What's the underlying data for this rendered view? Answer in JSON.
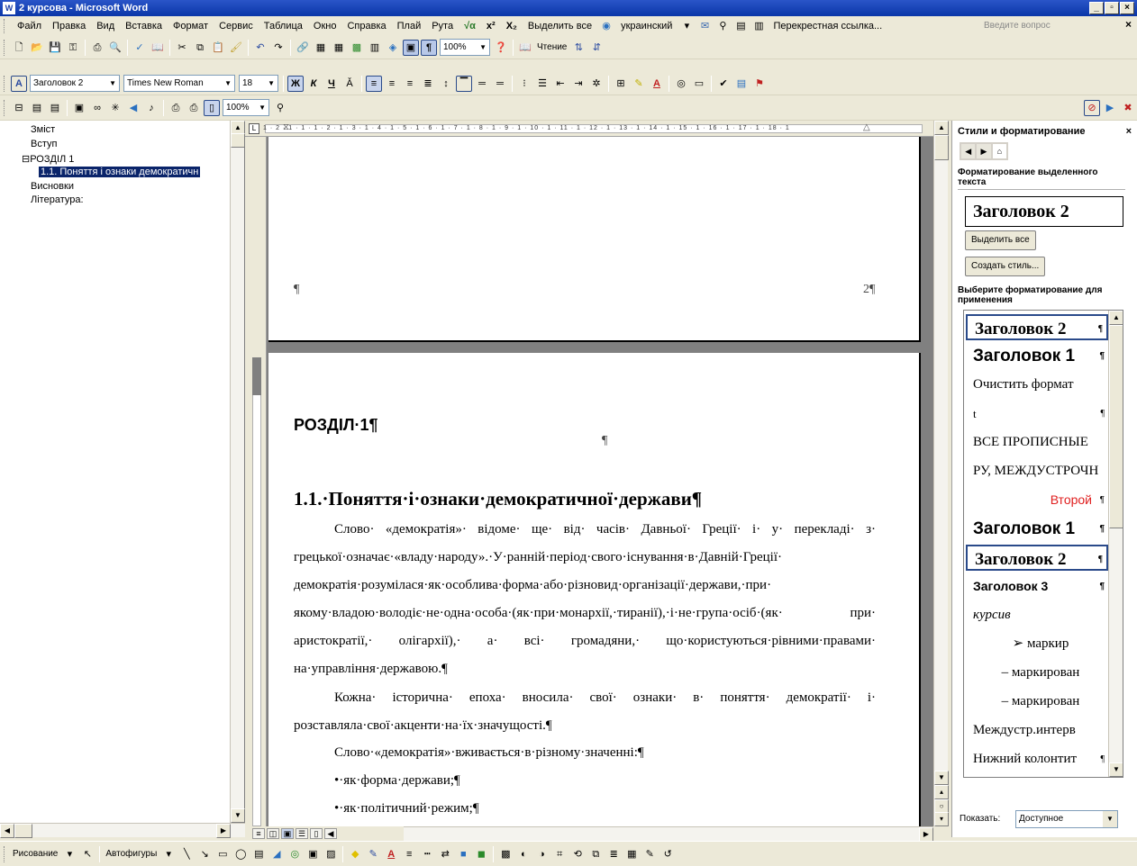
{
  "window": {
    "title": "2 курсова - Microsoft Word",
    "icon_letter": "W",
    "buttons": {
      "minimize": "_",
      "maximize": "▫",
      "close": "×"
    }
  },
  "menubar": {
    "items": [
      "Файл",
      "Правка",
      "Вид",
      "Вставка",
      "Формат",
      "Сервис",
      "Таблица",
      "Окно",
      "Справка",
      "Плай",
      "Рута"
    ],
    "extras": [
      "√α",
      "x²",
      "X₂",
      "Выделить все",
      "украинский",
      "Перекрестная ссылка..."
    ],
    "help_placeholder": "Введите вопрос",
    "close_label": "×"
  },
  "toolbar_standard": {
    "zoom": "100%",
    "reading_label": "Чтение"
  },
  "toolbar_formatting": {
    "style": "Заголовок 2",
    "font": "Times New Roman",
    "size": "18",
    "bold": "Ж",
    "italic": "К",
    "underline": "Ч"
  },
  "toolbar_extra": {
    "zoom": "100%"
  },
  "document_map": {
    "items": [
      {
        "label": "Зміст",
        "level": 1,
        "selected": false
      },
      {
        "label": "Вступ",
        "level": 1,
        "selected": false
      },
      {
        "label": "⊟РОЗДІЛ 1",
        "level": 1,
        "selected": false
      },
      {
        "label": "1.1. Поняття і ознаки демократичн",
        "level": 2,
        "selected": true
      },
      {
        "label": "Висновки",
        "level": 1,
        "selected": false
      },
      {
        "label": "Література:",
        "level": 1,
        "selected": false
      }
    ]
  },
  "ruler": {
    "numbers": "1 · 2 · 1 · 1 · 1 · 2 · 1 · 3 · 1 · 4 · 1 · 5 · 1 · 6 · 1 · 7 · 1 · 8 · 1 · 9 · 1 · 10 · 1 · 11 · 1 · 12 · 1 · 13 · 1 · 14 · 1 · 15 · 1 · 16 · 1 · 17 · 1 · 18 · 1"
  },
  "document": {
    "page1": {
      "pilcrow": "¶",
      "page_number": "2¶"
    },
    "chapter_heading": "РОЗДІЛ·1¶",
    "empty_para": "¶",
    "section_heading": "1.1.·Поняття·і·ознаки·демократичної·держави¶",
    "paragraph1": "Слово· «демократія»· відоме· ще· від· часів· Давньої· Греції· і· у· перекладі· з· грецької·означає·«владу·народу».·У·ранній·період·свого·існування·в·Давній·Греції· демократія·розумілася·як·особлива·форма·або·різновид·організації·держави,·при· якому·владою·володіє·не·одна·особа·(як·при·монархії,·тиранії),·і·не·група·осіб·(як· при· аристократії,· олігархії),· а· всі· громадяни,· що·користуються·рівними·правами· на·управління·державою.¶",
    "paragraph2": "Кожна· історична· епоха· вносила· свої· ознаки· в· поняття· демократії· і· розставляла·свої·акценти·на·їх·значущості.¶",
    "paragraph3": "Слово·«демократія»·вживається·в·різному·значенні:¶",
    "bullet1": "•·як·форма·держави;¶",
    "bullet2": "•·як·політичний·режим;¶"
  },
  "task_pane": {
    "title": "Стили и форматирование",
    "close": "×",
    "section_current": "Форматирование выделенного текста",
    "current_style": "Заголовок 2",
    "btn_select_all": "Выделить все",
    "btn_new_style": "Создать стиль...",
    "section_apply": "Выберите форматирование для применения",
    "styles": [
      {
        "label": "Заголовок 2",
        "font": "serif",
        "weight": "bold",
        "size": 19,
        "color": "#000000",
        "align": "left",
        "boxed": true,
        "mark": "¶"
      },
      {
        "label": "Заголовок 1",
        "font": "sans",
        "weight": "bold",
        "size": 19,
        "color": "#000000",
        "align": "left",
        "boxed": false,
        "mark": "¶"
      },
      {
        "label": "Очистить формат",
        "font": "serif",
        "weight": "normal",
        "size": 15,
        "color": "#000000",
        "align": "left",
        "boxed": false,
        "mark": ""
      },
      {
        "label": "t",
        "font": "serif",
        "weight": "normal",
        "size": 13,
        "color": "#000000",
        "align": "left",
        "boxed": false,
        "mark": "¶"
      },
      {
        "label": "ВСЕ ПРОПИСНЫЕ",
        "font": "serif",
        "weight": "normal",
        "size": 15,
        "color": "#000000",
        "align": "left",
        "boxed": false,
        "mark": ""
      },
      {
        "label": "РУ, МЕЖДУСТРОЧН",
        "font": "serif",
        "weight": "normal",
        "size": 15,
        "color": "#000000",
        "align": "left",
        "boxed": false,
        "mark": ""
      },
      {
        "label": "Второй",
        "font": "sans",
        "weight": "normal",
        "size": 14,
        "color": "#e02020",
        "align": "right",
        "boxed": false,
        "mark": "¶"
      },
      {
        "label": "Заголовок 1",
        "font": "sans",
        "weight": "bold",
        "size": 19,
        "color": "#000000",
        "align": "left",
        "boxed": false,
        "mark": "¶"
      },
      {
        "label": "Заголовок 2",
        "font": "serif",
        "weight": "bold",
        "size": 19,
        "color": "#000000",
        "align": "left",
        "boxed": true,
        "mark": "¶"
      },
      {
        "label": "Заголовок 3",
        "font": "sans",
        "weight": "bold",
        "size": 14,
        "color": "#000000",
        "align": "left",
        "boxed": false,
        "mark": "¶"
      },
      {
        "label": "курсив",
        "font": "serif",
        "weight": "italic",
        "size": 15,
        "color": "#000000",
        "align": "left",
        "boxed": false,
        "mark": ""
      },
      {
        "label": "➢    маркир",
        "font": "serif",
        "weight": "normal",
        "size": 15,
        "color": "#000000",
        "align": "center",
        "boxed": false,
        "mark": ""
      },
      {
        "label": "– маркирован",
        "font": "serif",
        "weight": "normal",
        "size": 15,
        "color": "#000000",
        "align": "center",
        "boxed": false,
        "mark": ""
      },
      {
        "label": "– маркирован",
        "font": "serif",
        "weight": "normal",
        "size": 15,
        "color": "#000000",
        "align": "center",
        "boxed": false,
        "mark": ""
      },
      {
        "label": "Междустр.интерв",
        "font": "serif",
        "weight": "normal",
        "size": 15,
        "color": "#000000",
        "align": "left",
        "boxed": false,
        "mark": ""
      },
      {
        "label": "Нижний колонтит",
        "font": "serif",
        "weight": "normal",
        "size": 15,
        "color": "#000000",
        "align": "left",
        "boxed": false,
        "mark": "¶"
      }
    ],
    "show_label": "Показать:",
    "show_value": "Доступное"
  },
  "drawing_toolbar": {
    "draw_label": "Рисование",
    "autoshapes_label": "Автофигуры"
  }
}
